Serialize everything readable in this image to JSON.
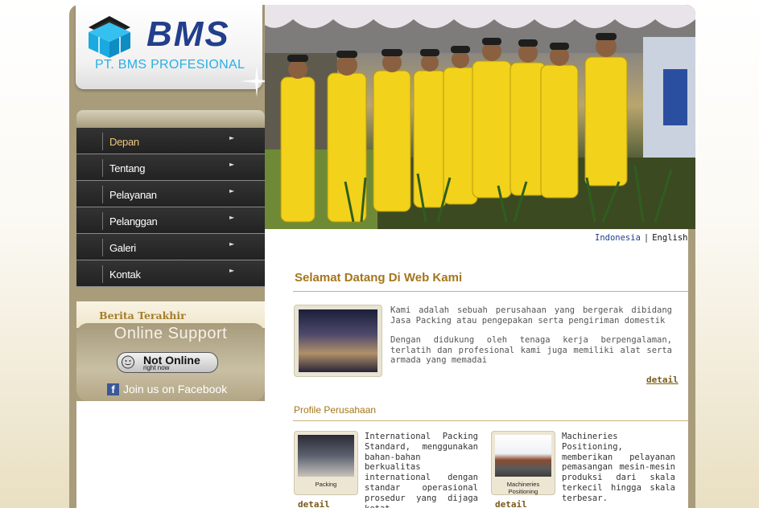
{
  "logo": {
    "brand": "BMS",
    "company": "PT. BMS PROFESIONAL"
  },
  "menu": [
    {
      "label": "Depan",
      "active": true
    },
    {
      "label": "Tentang"
    },
    {
      "label": "Pelayanan"
    },
    {
      "label": "Pelanggan"
    },
    {
      "label": "Galeri"
    },
    {
      "label": "Kontak"
    }
  ],
  "sidebar": {
    "news_title": "Berita Terakhir",
    "support_title": "Online Support",
    "status_main": "Not Online",
    "status_sub": "right now",
    "facebook_label": "Join us on Facebook"
  },
  "language": {
    "indonesia": "Indonesia",
    "separator": "|",
    "english": "English"
  },
  "welcome": {
    "title": "Selamat Datang Di Web Kami",
    "para1": "Kami adalah sebuah perusahaan yang bergerak dibidang Jasa Packing atau pengepakan serta pengiriman domestik",
    "para2": "Dengan didukung oleh tenaga kerja berpengalaman, terlatih dan profesional kami juga memiliki alat serta armada yang memadai",
    "detail": "detail"
  },
  "profile": {
    "title": "Profile Perusahaan",
    "cards": [
      {
        "label": "Packing",
        "text": "International Packing Standard, menggunakan bahan-bahan berkualitas international dengan standar operasional prosedur yang dijaga ketat.",
        "detail": "detail"
      },
      {
        "label": "Machineries Positioning",
        "text": "Machineries Positioning, memberikan pelayanan pemasangan mesin-mesin produksi dari skala terkecil hingga skala terbesar.",
        "detail": "detail"
      }
    ]
  },
  "colors": {
    "accent_gold": "#a4761c",
    "menu_bg": "#2a2a2a",
    "sidebar_khaki": "#a99c7b",
    "brand_blue": "#223e8c",
    "brand_cyan": "#29aee6"
  }
}
